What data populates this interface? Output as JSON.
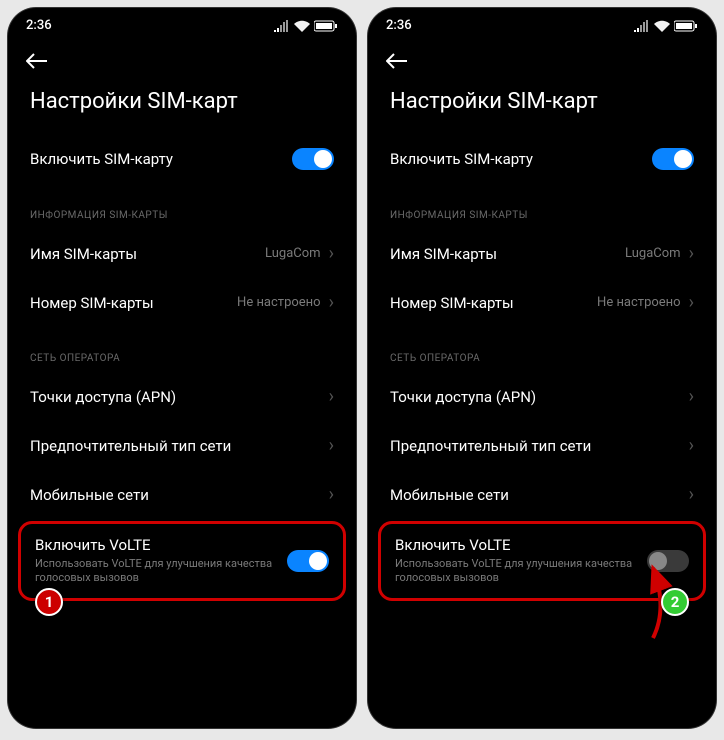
{
  "status": {
    "time": "2:36"
  },
  "title": "Настройки SIM-карт",
  "sim_enable": {
    "label": "Включить SIM-карту"
  },
  "section_info": "ИНФОРМАЦИЯ SIM-КАРТЫ",
  "sim_name": {
    "label": "Имя SIM-карты",
    "value": "LugaCom"
  },
  "sim_number": {
    "label": "Номер SIM-карты",
    "value": "Не настроено"
  },
  "section_network": "СЕТЬ ОПЕРАТОРА",
  "apn": {
    "label": "Точки доступа (APN)"
  },
  "net_type": {
    "label": "Предпочтительный тип сети"
  },
  "mobile_net": {
    "label": "Мобильные сети"
  },
  "volte": {
    "label": "Включить VoLTE",
    "desc": "Использовать VoLTE для улучшения качества голосовых вызовов"
  },
  "badges": {
    "one": "1",
    "two": "2"
  }
}
